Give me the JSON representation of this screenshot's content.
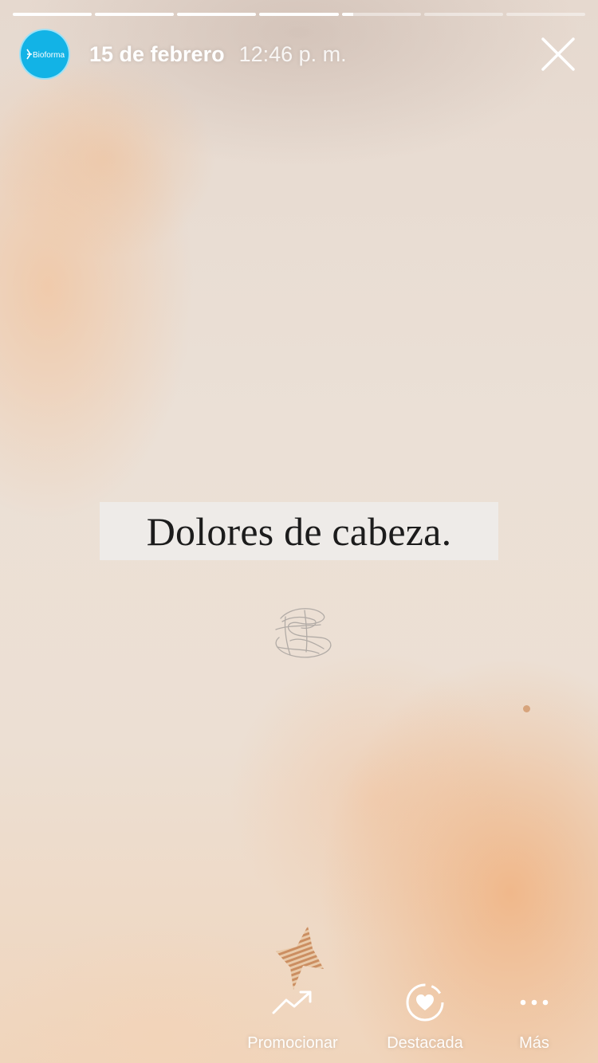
{
  "story": {
    "progress_segments": [
      {
        "fill": 1.0
      },
      {
        "fill": 1.0
      },
      {
        "fill": 1.0
      },
      {
        "fill": 1.0
      },
      {
        "fill": 0.15
      },
      {
        "fill": 0
      },
      {
        "fill": 0
      }
    ]
  },
  "header": {
    "avatar_logo_text": "Bioforma",
    "date": "15 de febrero",
    "time": "12:46 p. m.",
    "close_icon": "close-icon"
  },
  "content": {
    "headline": "Dolores de cabeza."
  },
  "actions": [
    {
      "label": "Promocionar",
      "icon": "trending-up-icon"
    },
    {
      "label": "Destacada",
      "icon": "highlight-heart-icon"
    },
    {
      "label": "Más",
      "icon": "more-dots-icon"
    }
  ],
  "colors": {
    "avatar_bg": "#12b3e6",
    "background": "#eadfd4",
    "headline_box": "#eeebe8",
    "text_white": "#ffffff"
  }
}
